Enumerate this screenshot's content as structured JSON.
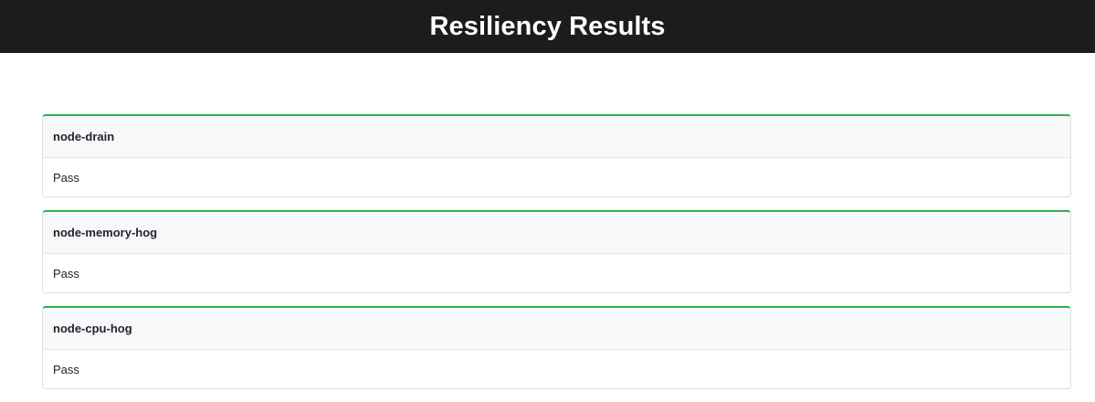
{
  "header": {
    "title": "Resiliency Results"
  },
  "results": [
    {
      "name": "node-drain",
      "status": "Pass"
    },
    {
      "name": "node-memory-hog",
      "status": "Pass"
    },
    {
      "name": "node-cpu-hog",
      "status": "Pass"
    }
  ],
  "colors": {
    "topbar": "#1b1c1e",
    "pass_accent": "#2fb34a",
    "card_header_bg": "#f7f8fa"
  }
}
